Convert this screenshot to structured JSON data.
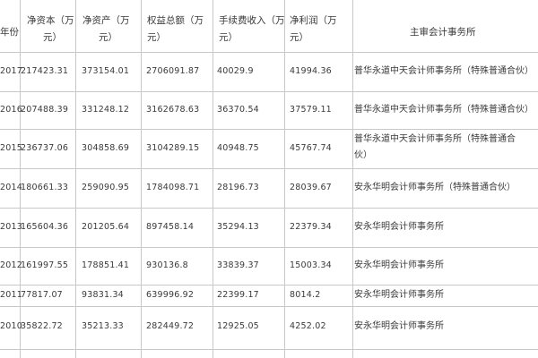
{
  "table": {
    "headers": {
      "year": "年份",
      "net_capital": [
        "净资本（万",
        "元）"
      ],
      "net_assets": [
        "净资产（万",
        "元）"
      ],
      "total_equity": [
        "权益总额（万",
        "元）"
      ],
      "fee_income": [
        "手续费收入（万",
        "元）"
      ],
      "net_profit": [
        "净利润（万",
        "元）"
      ],
      "auditor": "主审会计事务所"
    },
    "rows": [
      {
        "year": "2017",
        "net_capital": "217423.31",
        "net_assets": "373154.01",
        "total_equity": "2706091.87",
        "fee_income": "40029.9",
        "net_profit": "41994.36",
        "auditor": [
          "普华永道中天会计师事务所（特殊普通合伙）"
        ]
      },
      {
        "year": "2016",
        "net_capital": "207488.39",
        "net_assets": "331248.12",
        "total_equity": "3162678.63",
        "fee_income": "36370.54",
        "net_profit": "37579.11",
        "auditor": [
          "普华永道中天会计师事务所（特殊普通合伙）"
        ]
      },
      {
        "year": "2015",
        "net_capital": "236737.06",
        "net_assets": "304858.69",
        "total_equity": "3104289.15",
        "fee_income": "40948.75",
        "net_profit": "45767.74",
        "auditor": [
          "普华永道中天会计师事务所（特殊普通合",
          "伙）"
        ]
      },
      {
        "year": "2014",
        "net_capital": "180661.33",
        "net_assets": "259090.95",
        "total_equity": "1784098.71",
        "fee_income": "28196.73",
        "net_profit": "28039.67",
        "auditor": [
          "安永华明会计师事务所（特殊普通合伙）"
        ]
      },
      {
        "year": "2013",
        "net_capital": "165604.36",
        "net_assets": "201205.64",
        "total_equity": "897458.14",
        "fee_income": "35294.13",
        "net_profit": "22379.34",
        "auditor": [
          "安永华明会计师事务所"
        ]
      },
      {
        "year": "2012",
        "net_capital": "161997.55",
        "net_assets": "178851.41",
        "total_equity": "930136.8",
        "fee_income": "33839.37",
        "net_profit": "15003.34",
        "auditor": [
          "安永华明会计师事务所"
        ]
      },
      {
        "year": "2011",
        "net_capital": "77817.07",
        "net_assets": "93831.34",
        "total_equity": "639996.92",
        "fee_income": "22399.17",
        "net_profit": "8014.2",
        "auditor": [
          "安永华明会计师事务所"
        ]
      },
      {
        "year": "2010",
        "net_capital": "35822.72",
        "net_assets": "35213.33",
        "total_equity": "282449.72",
        "fee_income": "12925.05",
        "net_profit": "4252.02",
        "auditor": [
          "安永华明会计师事务所"
        ]
      }
    ]
  }
}
